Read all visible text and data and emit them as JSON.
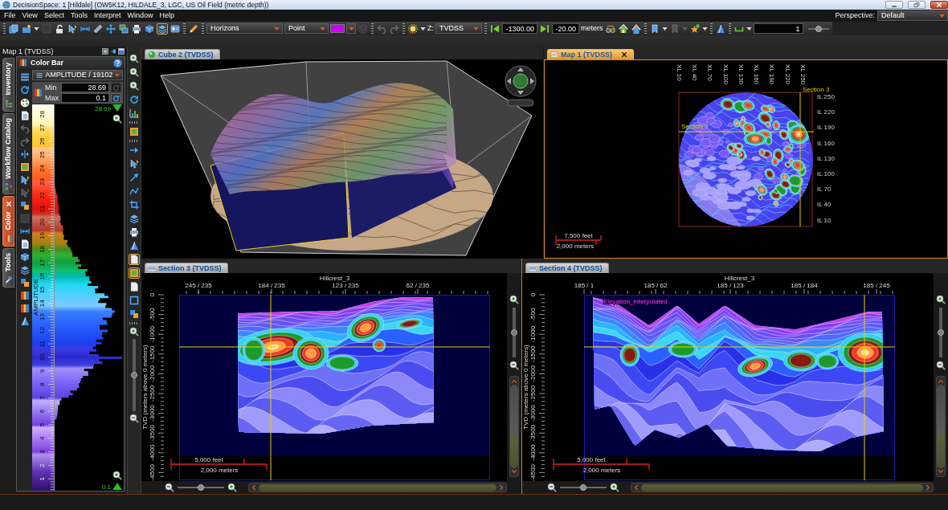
{
  "window": {
    "title": "DecisionSpace: 1 [Hildale] (OW5K12, HILDALE_3, LGC, US Oil Field (metric depth))"
  },
  "menu": [
    "File",
    "View",
    "Select",
    "Tools",
    "Interpret",
    "Window",
    "Help"
  ],
  "perspective": {
    "label": "Perspective:",
    "value": "Default"
  },
  "toolbar": {
    "buttons": [
      {
        "selected": false,
        "disabled": false
      },
      {
        "selected": false,
        "disabled": false
      },
      {
        "selected": false,
        "disabled": true
      },
      {
        "selected": false,
        "disabled": false
      },
      {
        "selected": false,
        "disabled": false
      },
      {
        "selected": false,
        "disabled": false
      },
      {
        "selected": false,
        "disabled": false
      },
      {
        "selected": false,
        "disabled": false
      },
      {
        "selected": false,
        "disabled": false
      },
      {
        "selected": false,
        "disabled": false
      },
      {
        "selected": false,
        "disabled": false
      },
      {
        "selected": true,
        "disabled": false
      },
      {
        "selected": false,
        "disabled": false
      },
      {
        "selected": false,
        "disabled": false
      },
      {
        "selected": false,
        "disabled": true
      },
      {
        "selected": false,
        "disabled": true
      },
      {
        "selected": false,
        "disabled": true
      },
      {
        "selected": false,
        "disabled": false
      },
      {
        "selected": false,
        "disabled": false
      },
      {
        "selected": false,
        "disabled": false
      },
      {
        "selected": false,
        "disabled": false
      },
      {
        "selected": false,
        "disabled": false
      },
      {
        "selected": false,
        "disabled": false
      },
      {
        "selected": false,
        "disabled": false
      },
      {
        "selected": false,
        "disabled": true
      },
      {
        "selected": false,
        "disabled": false
      },
      {
        "selected": false,
        "disabled": false
      },
      {
        "selected": false,
        "disabled": false
      }
    ],
    "layer_dropdown": "Horizons",
    "mode_dropdown": "Point",
    "color": "#cc00ff",
    "z_label": "Z:",
    "z_dropdown": "TVDSS",
    "depth_field": "-1300.00",
    "step_field": "-20.00",
    "unit": "meters",
    "count_field": "1",
    "slider": {
      "level": 0.5
    }
  },
  "left_panel": {
    "title": "Map 1 (TVDSS)",
    "side_tabs": [
      {
        "label": "Inventory",
        "selected": false
      },
      {
        "label": "Workflow Catalog",
        "selected": false
      },
      {
        "label": "Color",
        "selected": true
      },
      {
        "label": "Tools",
        "selected": false
      }
    ]
  },
  "color_bar": {
    "title": "Color Bar",
    "attribute": "AMPLITUDE / 19102",
    "min_label": "Min",
    "min": "28.69",
    "min_button": {
      "disabled": true
    },
    "max_label": "Max",
    "max": "0.1",
    "max_button": {
      "disabled": false
    },
    "axis_title": "AMPLITUDE",
    "ticks": [
      "1",
      "2",
      "3",
      "4",
      "5",
      "6",
      "7",
      "8",
      "9",
      "10",
      "11",
      "12",
      "13",
      "14",
      "15",
      "16",
      "17",
      "18",
      "19",
      "20",
      "21",
      "22",
      "23",
      "24",
      "25",
      "26",
      "27",
      "28"
    ],
    "top_value": "28.69",
    "bottom_value": "0.1",
    "tools": [
      {
        "disabled": false
      },
      {
        "disabled": false
      },
      {
        "disabled": false
      },
      {
        "disabled": false
      },
      {
        "disabled": true
      },
      {
        "disabled": true
      },
      {
        "disabled": false
      },
      {
        "disabled": false
      },
      {
        "disabled": false
      },
      {
        "disabled": true
      },
      {
        "disabled": false
      },
      {
        "disabled": true
      },
      {
        "disabled": false
      },
      {
        "disabled": false
      },
      {
        "disabled": false
      },
      {
        "disabled": false
      },
      {
        "disabled": false
      },
      {
        "disabled": false
      },
      {
        "disabled": false
      },
      {
        "disabled": false
      }
    ]
  },
  "tool_strip": {
    "tools": [
      {
        "selected": false
      },
      {
        "selected": false
      },
      {
        "selected": false
      },
      {
        "selected": false
      },
      {
        "selected": false
      },
      {
        "selected": false
      },
      {
        "selected": false
      },
      {
        "selected": false
      },
      {
        "selected": false
      },
      {
        "selected": false
      },
      {
        "selected": false
      },
      {
        "selected": false
      },
      {
        "selected": false
      },
      {
        "selected": false
      },
      {
        "selected": true
      },
      {
        "selected": true
      },
      {
        "selected": false
      },
      {
        "selected": false
      },
      {
        "selected": false
      }
    ],
    "zoom": {
      "level": 0.5
    }
  },
  "cube_view": {
    "tab": {
      "label": "Cube 2 (TVDSS)",
      "selected": false
    }
  },
  "map_view": {
    "tab": {
      "label": "Map 1 (TVDSS)",
      "selected": true
    },
    "crosslines": [
      "XL 10",
      "XL 40",
      "XL 70",
      "XL 100",
      "XL 130",
      "XL 160",
      "XL 190",
      "XL 220",
      "XL 250"
    ],
    "inlines": [
      "IL 250",
      "IL 220",
      "IL 190",
      "IL 160",
      "IL 130",
      "IL 100",
      "IL 70",
      "IL 40",
      "IL 10"
    ],
    "section_labels": [
      "Section 3",
      "Section 4"
    ],
    "scale": [
      "7,500 feet",
      "2,000 meters"
    ]
  },
  "sections": [
    {
      "tab": {
        "label": "Section 3 (TVDSS)",
        "selected": false
      },
      "line": "Hillcrest_3",
      "traces": [
        "245 / 235",
        "184 / 235",
        "123 / 235",
        "62 / 235"
      ],
      "axis_title": "TVD (meters above 0 meters)",
      "depths": [
        "0",
        "-500",
        "-1000",
        "-1500",
        "-2000",
        "-2500",
        "-3000",
        "-3500",
        "-4000",
        "-4500"
      ],
      "scale": [
        "5,000 feet",
        "2,000 meters"
      ],
      "horizontal_zoom": {
        "level": 0.5
      },
      "vertical_zoom": {
        "level": 0.5
      }
    },
    {
      "tab": {
        "label": "Section 4 (TVDSS)",
        "selected": false
      },
      "line": "Hillcrest_3",
      "traces": [
        "185 / 1",
        "185 / 62",
        "185 / 123",
        "185 / 184",
        "185 / 245"
      ],
      "axis_title": "TVD (meters above 0 meters)",
      "depths": [
        "0",
        "-500",
        "-1000",
        "-1500",
        "-2000",
        "-2500",
        "-3000",
        "-3500",
        "-4000",
        "-4500"
      ],
      "horizon_label": "Elevation_Interpolated",
      "scale": [
        "5,000 feet",
        "2,000 meters"
      ],
      "horizontal_zoom": {
        "level": 0.5
      },
      "vertical_zoom": {
        "level": 0.5
      }
    }
  ]
}
